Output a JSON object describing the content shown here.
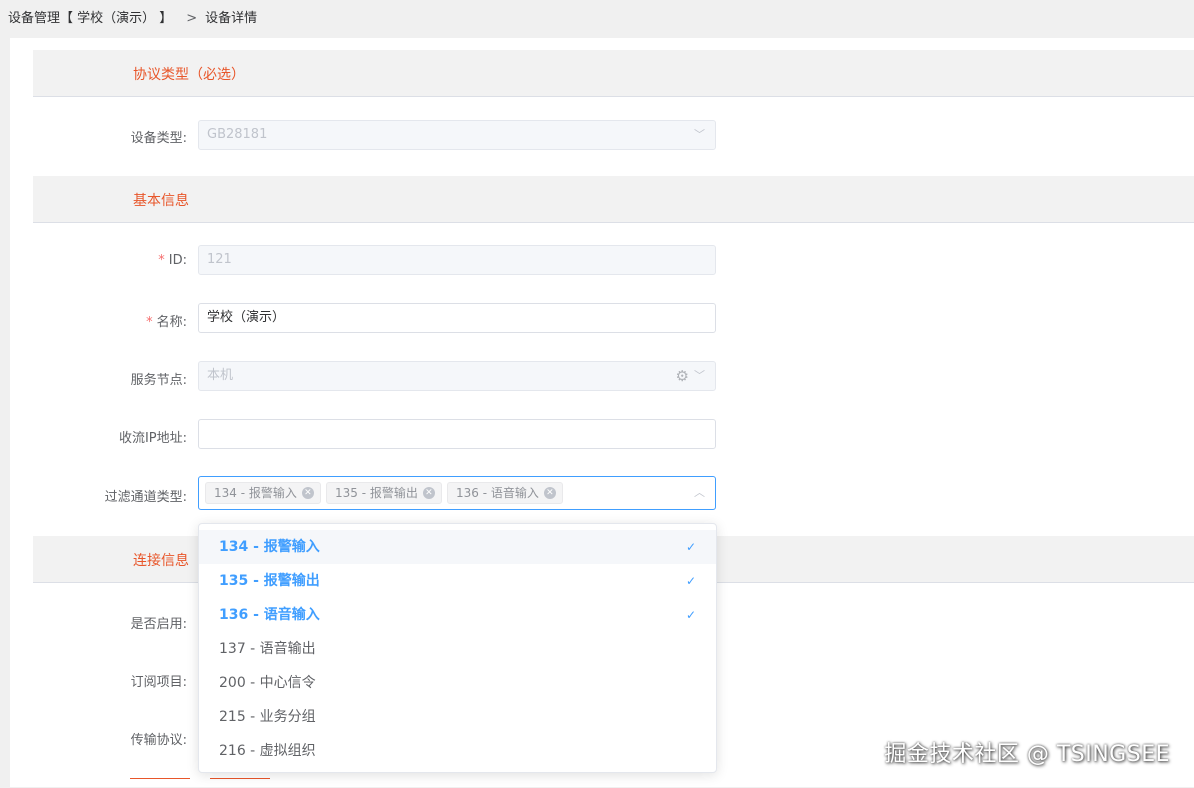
{
  "breadcrumb": {
    "root": "设备管理【 学校（演示） 】",
    "separator": ">",
    "current": "设备详情"
  },
  "sections": {
    "protocol": "协议类型（必选）",
    "basic": "基本信息",
    "connection": "连接信息"
  },
  "form": {
    "device_type": {
      "label": "设备类型:",
      "value": "GB28181"
    },
    "id": {
      "required_mark": "*",
      "label": "ID:",
      "value": "121"
    },
    "name": {
      "required_mark": "*",
      "label": "名称:",
      "value": "学校（演示）"
    },
    "service_node": {
      "label": "服务节点:",
      "value": "本机"
    },
    "stream_ip": {
      "label": "收流IP地址:",
      "value": ""
    },
    "filter_channel": {
      "label": "过滤通道类型:",
      "tags": [
        "134 - 报警输入",
        "135 - 报警输出",
        "136 - 语音输入"
      ]
    },
    "enabled": {
      "label": "是否启用:"
    },
    "subscription": {
      "label": "订阅项目:"
    },
    "transport": {
      "label": "传输协议:"
    }
  },
  "dropdown": {
    "options": [
      {
        "label": "134 - 报警输入",
        "selected": true
      },
      {
        "label": "135 - 报警输出",
        "selected": true
      },
      {
        "label": "136 - 语音输入",
        "selected": true
      },
      {
        "label": "137 - 语音输出",
        "selected": false
      },
      {
        "label": "200 - 中心信令",
        "selected": false
      },
      {
        "label": "215 - 业务分组",
        "selected": false
      },
      {
        "label": "216 - 虚拟组织",
        "selected": false
      }
    ]
  },
  "watermark": {
    "text": "掘金技术社区 @ TSINGSEE"
  },
  "icons": {
    "check": "check-icon",
    "close": "tag-close-icon",
    "arrow": "chevron-icon",
    "gear": "gear-icon"
  },
  "colors": {
    "accent": "#409eff",
    "section_title": "#e8562a",
    "required": "#f56c6c"
  }
}
